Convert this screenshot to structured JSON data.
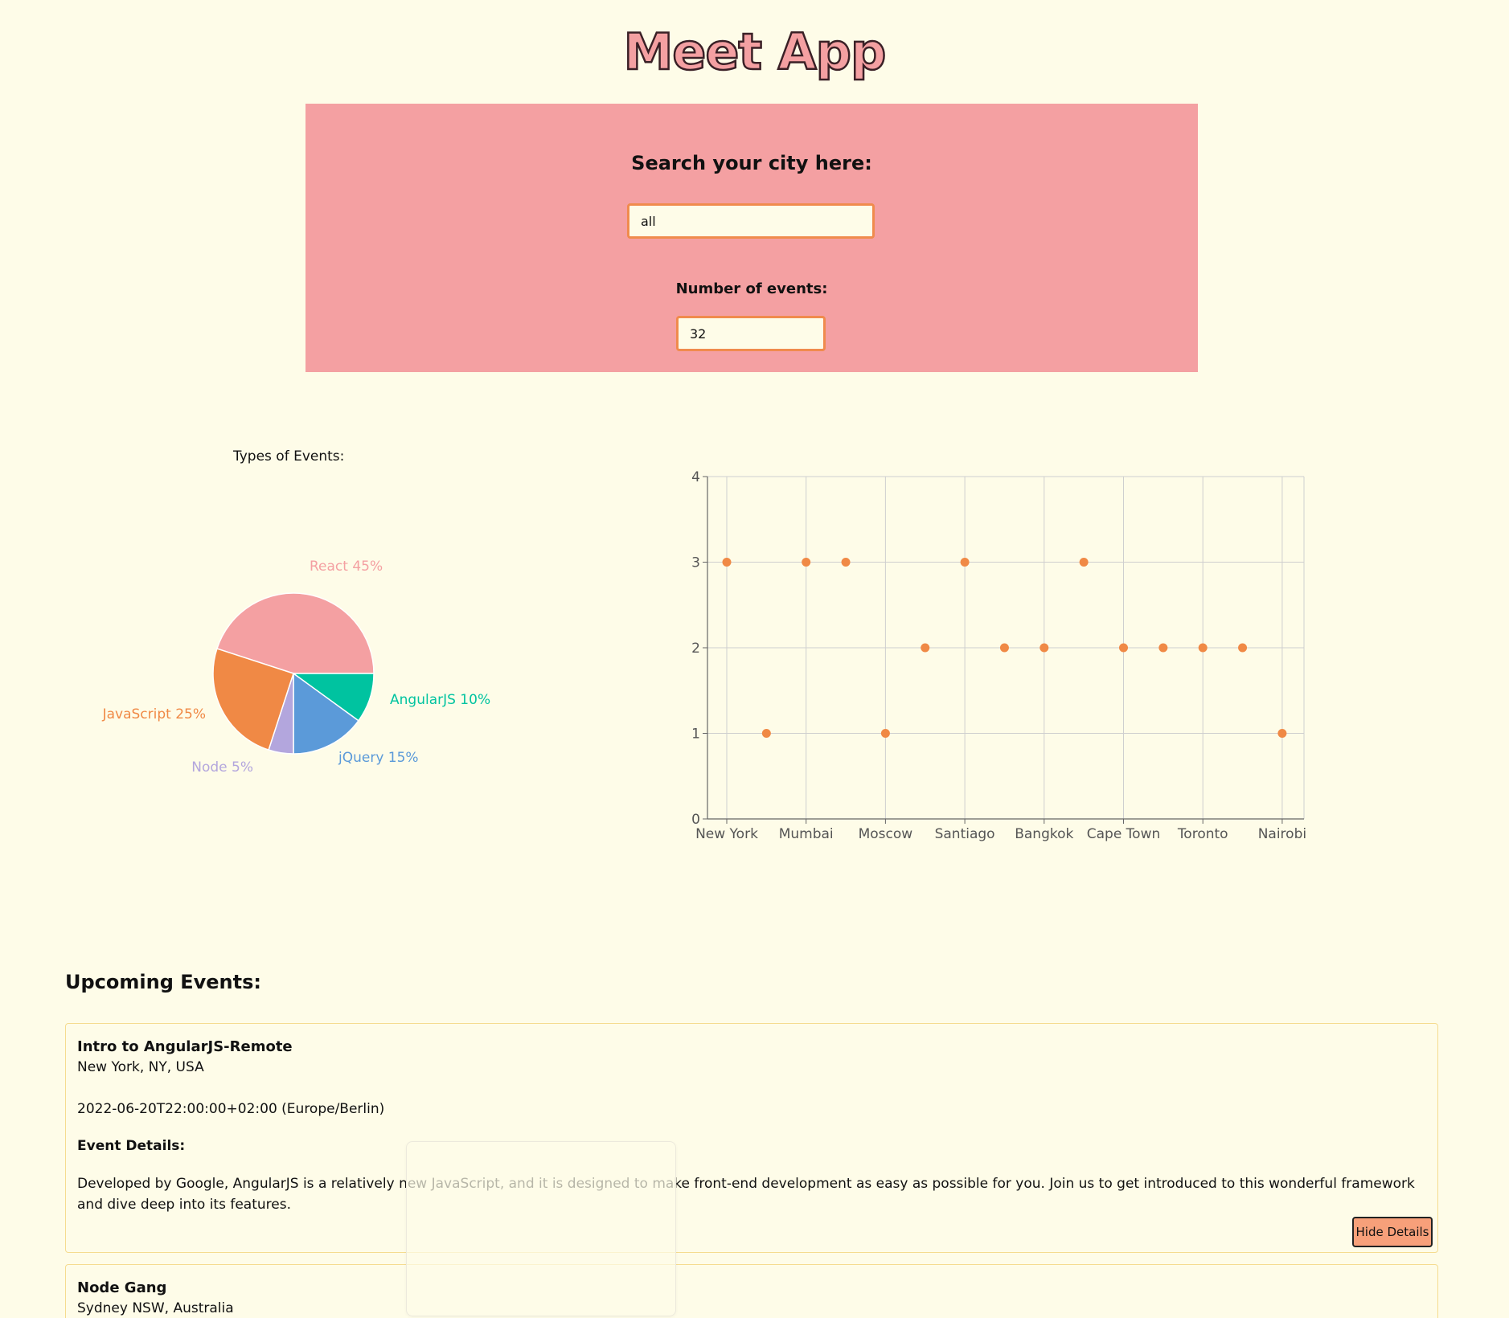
{
  "app": {
    "title": "Meet App"
  },
  "search": {
    "city_label": "Search your city here:",
    "city_value": "all",
    "number_label": "Number of events:",
    "number_value": "32"
  },
  "pie_title": "Types of Events:",
  "chart_data": [
    {
      "type": "pie",
      "title": "Types of Events:",
      "slices": [
        {
          "label": "React",
          "value": 45,
          "display": "React 45%",
          "color": "#f4a0a2"
        },
        {
          "label": "AngularJS",
          "value": 10,
          "display": "AngularJS 10%",
          "color": "#00c3a0"
        },
        {
          "label": "jQuery",
          "value": 15,
          "display": "jQuery 15%",
          "color": "#5b9ad9"
        },
        {
          "label": "Node",
          "value": 5,
          "display": "Node 5%",
          "color": "#b3a6dd"
        },
        {
          "label": "JavaScript",
          "value": 25,
          "display": "JavaScript 25%",
          "color": "#f08945"
        }
      ]
    },
    {
      "type": "scatter",
      "color": "#f08945",
      "xlabels": [
        "New York",
        "Mumbai",
        "Moscow",
        "Santiago",
        "Bangkok",
        "Cape Town",
        "Toronto",
        "Nairobi"
      ],
      "ylim": [
        0,
        4
      ],
      "yticks": [
        0,
        1,
        2,
        3,
        4
      ],
      "points": [
        {
          "x": 0,
          "y": 3
        },
        {
          "x": 1,
          "y": 1
        },
        {
          "x": 2,
          "y": 3
        },
        {
          "x": 3,
          "y": 3
        },
        {
          "x": 4,
          "y": 1
        },
        {
          "x": 5,
          "y": 2
        },
        {
          "x": 6,
          "y": 3
        },
        {
          "x": 7,
          "y": 2
        },
        {
          "x": 8,
          "y": 2
        },
        {
          "x": 9,
          "y": 3
        },
        {
          "x": 10,
          "y": 2
        },
        {
          "x": 11,
          "y": 2
        },
        {
          "x": 12,
          "y": 2
        },
        {
          "x": 13,
          "y": 2
        },
        {
          "x": 14,
          "y": 1
        }
      ],
      "grid": true
    }
  ],
  "upcoming_title": "Upcoming Events:",
  "events": [
    {
      "title": "Intro to AngularJS-Remote",
      "location": "New York, NY, USA",
      "date": "2022-06-20T22:00:00+02:00 (Europe/Berlin)",
      "details_heading": "Event Details:",
      "description": "Developed by Google, AngularJS is a relatively new JavaScript, and it is designed to make front-end development as easy as possible for you. Join us to get introduced to this wonderful framework and dive deep into its features.",
      "button_label": "Hide Details"
    },
    {
      "title": "Node Gang",
      "location": "Sydney NSW, Australia"
    }
  ]
}
